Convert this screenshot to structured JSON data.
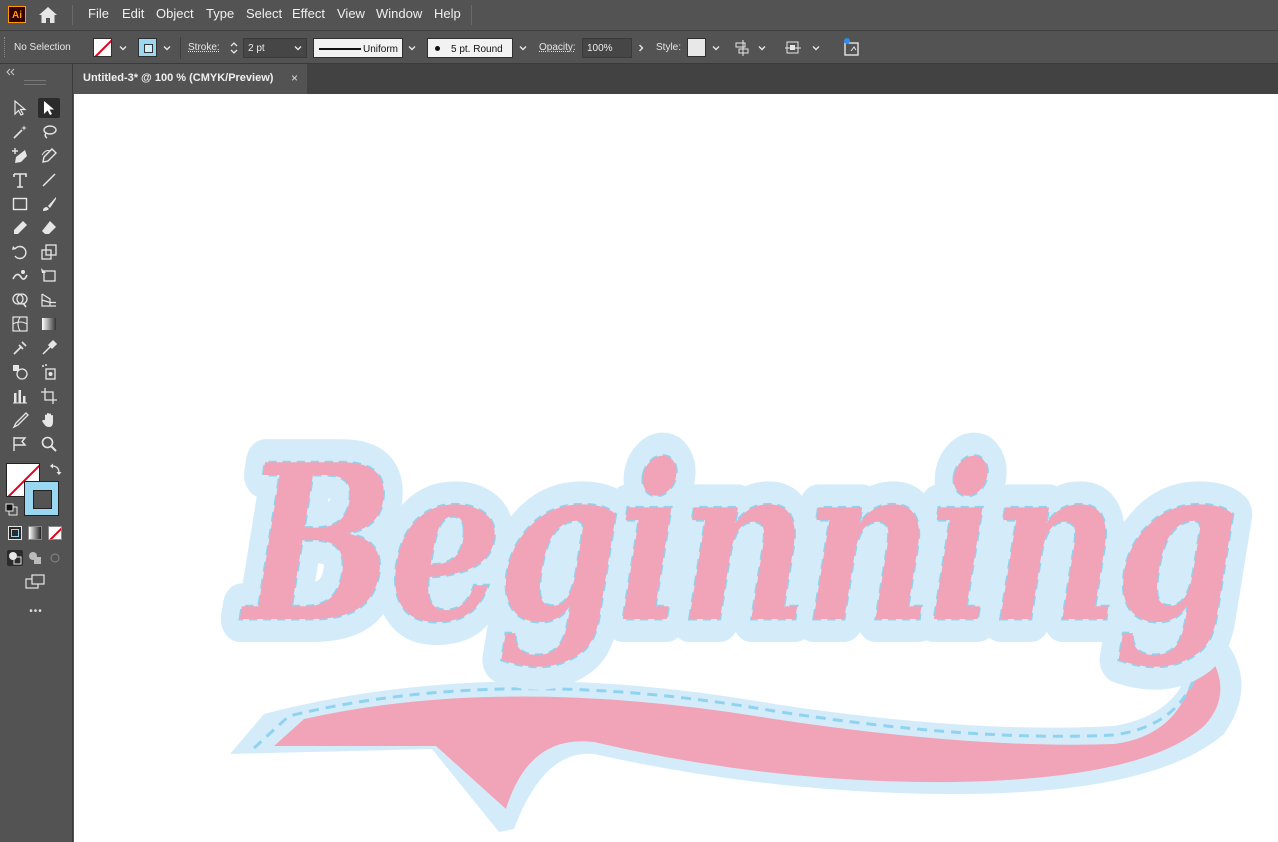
{
  "app": {
    "logo_text": "Ai"
  },
  "menus": [
    "File",
    "Edit",
    "Object",
    "Type",
    "Select",
    "Effect",
    "View",
    "Window",
    "Help"
  ],
  "control_bar": {
    "selection_status": "No Selection",
    "stroke_label": "Stroke:",
    "stroke_weight": "2 pt",
    "stroke_profile": "Uniform",
    "brush": "5 pt. Round",
    "opacity_label": "Opacity:",
    "opacity_value": "100%",
    "style_label": "Style:"
  },
  "document": {
    "tab_title": "Untitled-3* @ 100 % (CMYK/Preview)",
    "close_glyph": "×"
  },
  "artwork": {
    "text": "Beginning",
    "fill_color": "#f1a4b8",
    "outline_color": "#d4ecf9",
    "dash_color": "#8fd3f0"
  },
  "colors": {
    "ui_panel": "#535353",
    "ui_dark": "#424242",
    "canvas": "#ffffff",
    "stroke_swatch": "#9ad7f0"
  },
  "toolbar": {
    "more_glyph": "•••"
  }
}
